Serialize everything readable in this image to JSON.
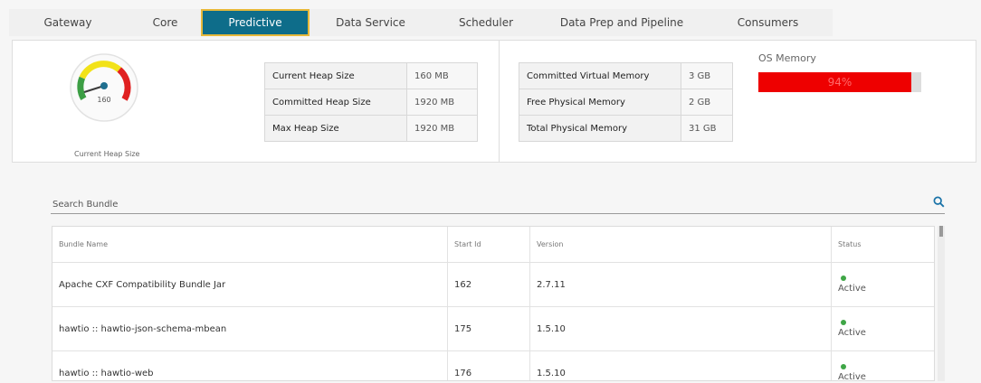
{
  "tabs": [
    {
      "label": "Gateway",
      "active": false
    },
    {
      "label": "Core",
      "active": false
    },
    {
      "label": "Predictive",
      "active": true
    },
    {
      "label": "Data Service",
      "active": false
    },
    {
      "label": "Scheduler",
      "active": false
    },
    {
      "label": "Data Prep and Pipeline",
      "active": false
    },
    {
      "label": "Consumers",
      "active": false
    }
  ],
  "gauge": {
    "value": "160",
    "caption": "Current Heap Size"
  },
  "heap": [
    {
      "key": "Current Heap Size",
      "value": "160 MB"
    },
    {
      "key": "Committed Heap Size",
      "value": "1920 MB"
    },
    {
      "key": "Max Heap Size",
      "value": "1920 MB"
    }
  ],
  "memory": [
    {
      "key": "Committed Virtual Memory",
      "value": "3 GB"
    },
    {
      "key": "Free Physical Memory",
      "value": "2 GB"
    },
    {
      "key": "Total Physical Memory",
      "value": "31 GB"
    }
  ],
  "os_memory": {
    "label": "OS Memory",
    "percent_text": "94%",
    "percent": 94,
    "fill_color": "#ee0000"
  },
  "search": {
    "placeholder": "Search Bundle"
  },
  "bundles": {
    "headers": [
      "Bundle Name",
      "Start Id",
      "Version",
      "Status"
    ],
    "rows": [
      {
        "name": "Apache CXF Compatibility Bundle Jar",
        "start_id": "162",
        "version": "2.7.11",
        "status": "Active"
      },
      {
        "name": "hawtio :: hawtio-json-schema-mbean",
        "start_id": "175",
        "version": "1.5.10",
        "status": "Active"
      },
      {
        "name": "hawtio :: hawtio-web",
        "start_id": "176",
        "version": "1.5.10",
        "status": "Active"
      }
    ]
  },
  "colors": {
    "active_tab": "#0e6d8a",
    "active_tab_border": "#e7b93a",
    "status_active": "#3fa646",
    "search_icon": "#1a73a8"
  }
}
